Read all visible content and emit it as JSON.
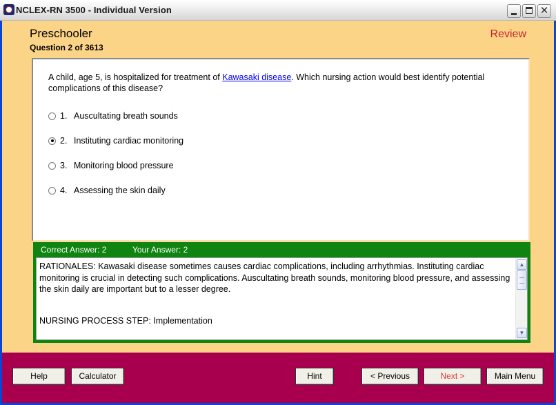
{
  "window": {
    "title": "NCLEX-RN 3500 - Individual Version"
  },
  "header": {
    "topic": "Preschooler",
    "question_counter": "Question 2 of 3613",
    "mode": "Review"
  },
  "question": {
    "stem_before_link": "A child, age 5, is hospitalized for treatment of ",
    "stem_link": "Kawasaki disease",
    "stem_after_link": ". Which nursing action would best identify potential complications of this disease?",
    "choices": [
      {
        "number": "1.",
        "text": "Auscultating breath sounds",
        "selected": false
      },
      {
        "number": "2.",
        "text": "Instituting cardiac monitoring",
        "selected": true
      },
      {
        "number": "3.",
        "text": "Monitoring blood pressure",
        "selected": false
      },
      {
        "number": "4.",
        "text": "Assessing the skin daily",
        "selected": false
      }
    ]
  },
  "answer": {
    "correct_answer": "Correct Answer: 2",
    "your_answer": "Your Answer: 2",
    "rationale": "RATIONALES: Kawasaki disease sometimes causes cardiac complications, including arrhythmias. Instituting cardiac monitoring is crucial in detecting such complications. Auscultating breath sounds, monitoring blood pressure, and assessing the skin daily are important but to a lesser degree.",
    "process_step": "NURSING PROCESS STEP: Implementation"
  },
  "footer": {
    "help_label": "Help",
    "calculator_label": "Calculator",
    "hint_label": "Hint",
    "previous_label": "< Previous",
    "next_label": "Next >",
    "main_menu_label": "Main Menu"
  },
  "colors": {
    "background": "#fcd488",
    "answer_bar": "#108410",
    "footer": "#a8004e",
    "review_text": "#c8242a",
    "disabled_button_text": "#d43a3a"
  }
}
